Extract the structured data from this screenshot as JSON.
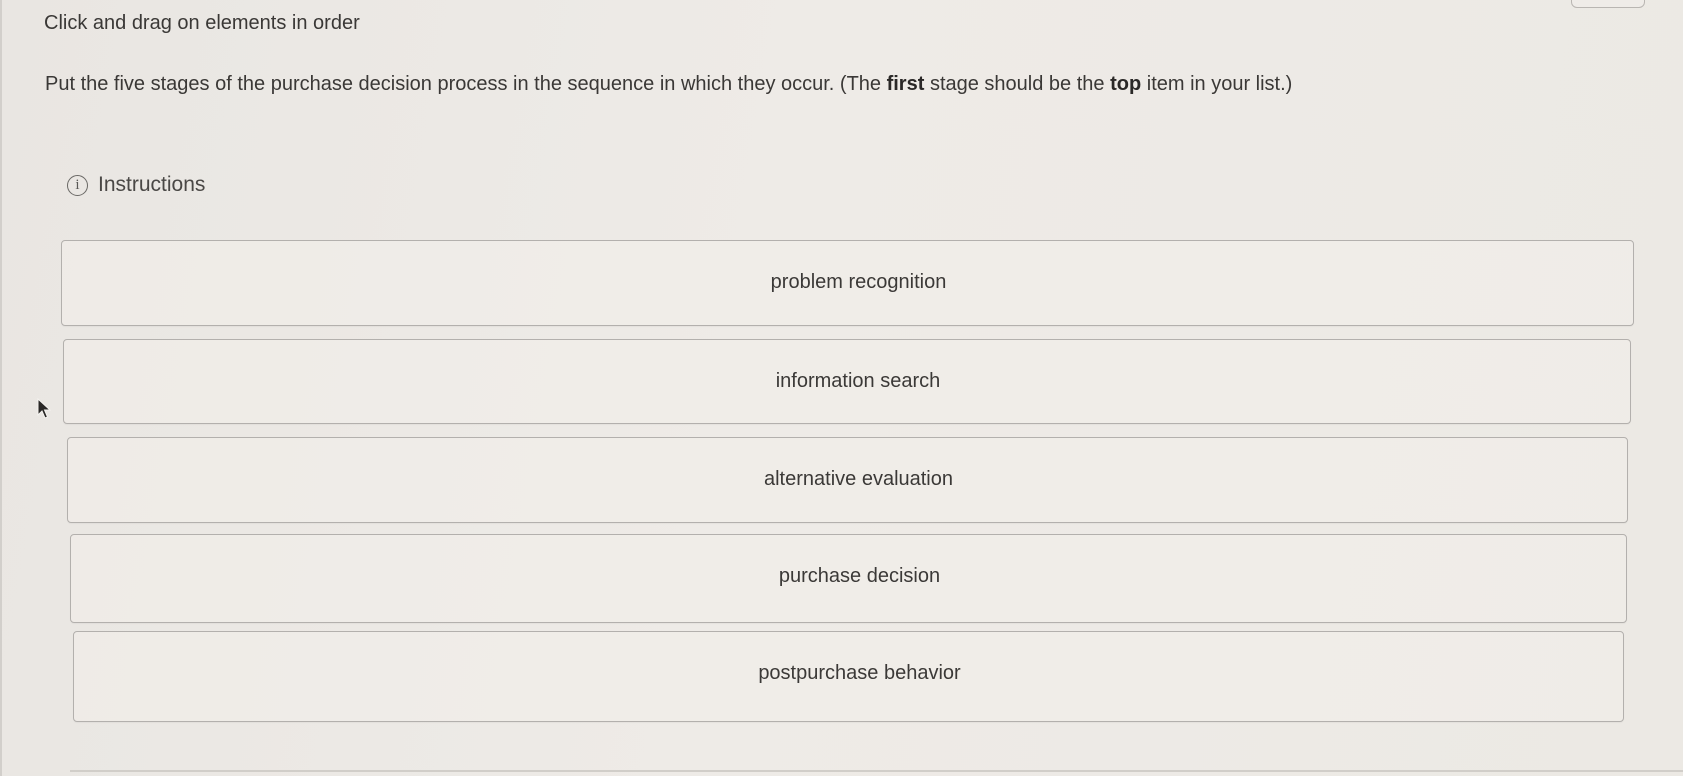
{
  "header": {
    "title": "Click and drag on elements in order"
  },
  "question": {
    "prompt_before_first": "Put the five stages of the purchase decision process in the sequence in which they occur. (The ",
    "bold_first": "first",
    "prompt_middle": " stage should be the ",
    "bold_top": "top",
    "prompt_after": " item in your list.)"
  },
  "instructions": {
    "label": "Instructions",
    "icon": "info-icon",
    "icon_glyph": "i"
  },
  "order_list": {
    "items": [
      {
        "label": "problem recognition"
      },
      {
        "label": "information search"
      },
      {
        "label": "alternative evaluation"
      },
      {
        "label": "purchase decision"
      },
      {
        "label": "postpurchase behavior"
      }
    ]
  },
  "colors": {
    "background": "#ece9e4",
    "border": "#b3b0ad",
    "text": "#3a3836"
  }
}
